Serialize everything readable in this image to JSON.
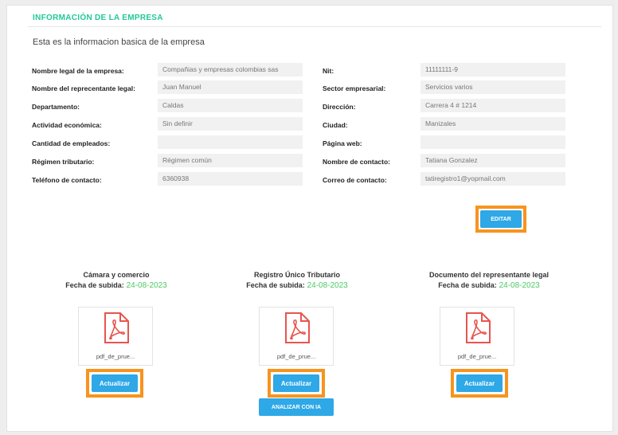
{
  "header": {
    "title": "INFORMACIÓN DE LA EMPRESA",
    "subtitle": "Esta es la informacion basica de la empresa"
  },
  "left_fields": [
    {
      "label": "Nombre legal de la empresa:",
      "value": "Compañias y empresas colombias sas"
    },
    {
      "label": "Nombre del reprecentante legal:",
      "value": "Juan  Manuel"
    },
    {
      "label": "Departamento:",
      "value": "Caldas"
    },
    {
      "label": "Actividad económica:",
      "value": "Sin definir"
    },
    {
      "label": "Cantidad de empleados:",
      "value": ""
    },
    {
      "label": "Régimen tributario:",
      "value": "Régimen común"
    },
    {
      "label": "Teléfono de contacto:",
      "value": "6360938"
    }
  ],
  "right_fields": [
    {
      "label": "Nit:",
      "value": "11111111-9"
    },
    {
      "label": "Sector empresarial:",
      "value": "Servicios varios"
    },
    {
      "label": "Dirección:",
      "value": "Carrera 4 # 1214"
    },
    {
      "label": "Ciudad:",
      "value": "Manizales"
    },
    {
      "label": "Página web:",
      "value": ""
    },
    {
      "label": "Nombre de contacto:",
      "value": "Tatiana Gonzalez"
    },
    {
      "label": "Correo de contacto:",
      "value": "tatiregistro1@yopmail.com"
    }
  ],
  "edit_button": "EDITAR",
  "documents": [
    {
      "title": "Cámara y comercio",
      "date_label": "Fecha de subida:",
      "date": "24-08-2023",
      "file": "pdf_de_prue...",
      "button": "Actualizar"
    },
    {
      "title": "Registro Único Tributario",
      "date_label": "Fecha de subida:",
      "date": "24-08-2023",
      "file": "pdf_de_prue...",
      "button": "Actualizar"
    },
    {
      "title": "Documento del representante legal",
      "date_label": "Fecha de subida:",
      "date": "24-08-2023",
      "file": "pdf_de_prue...",
      "button": "Actualizar"
    }
  ],
  "analyze_button": "ANALIZAR CON IA",
  "colors": {
    "accent_title": "#20c997",
    "button": "#2ea8e6",
    "highlight": "#f7941d",
    "date": "#4cc964",
    "pdf_icon": "#e8544d"
  }
}
